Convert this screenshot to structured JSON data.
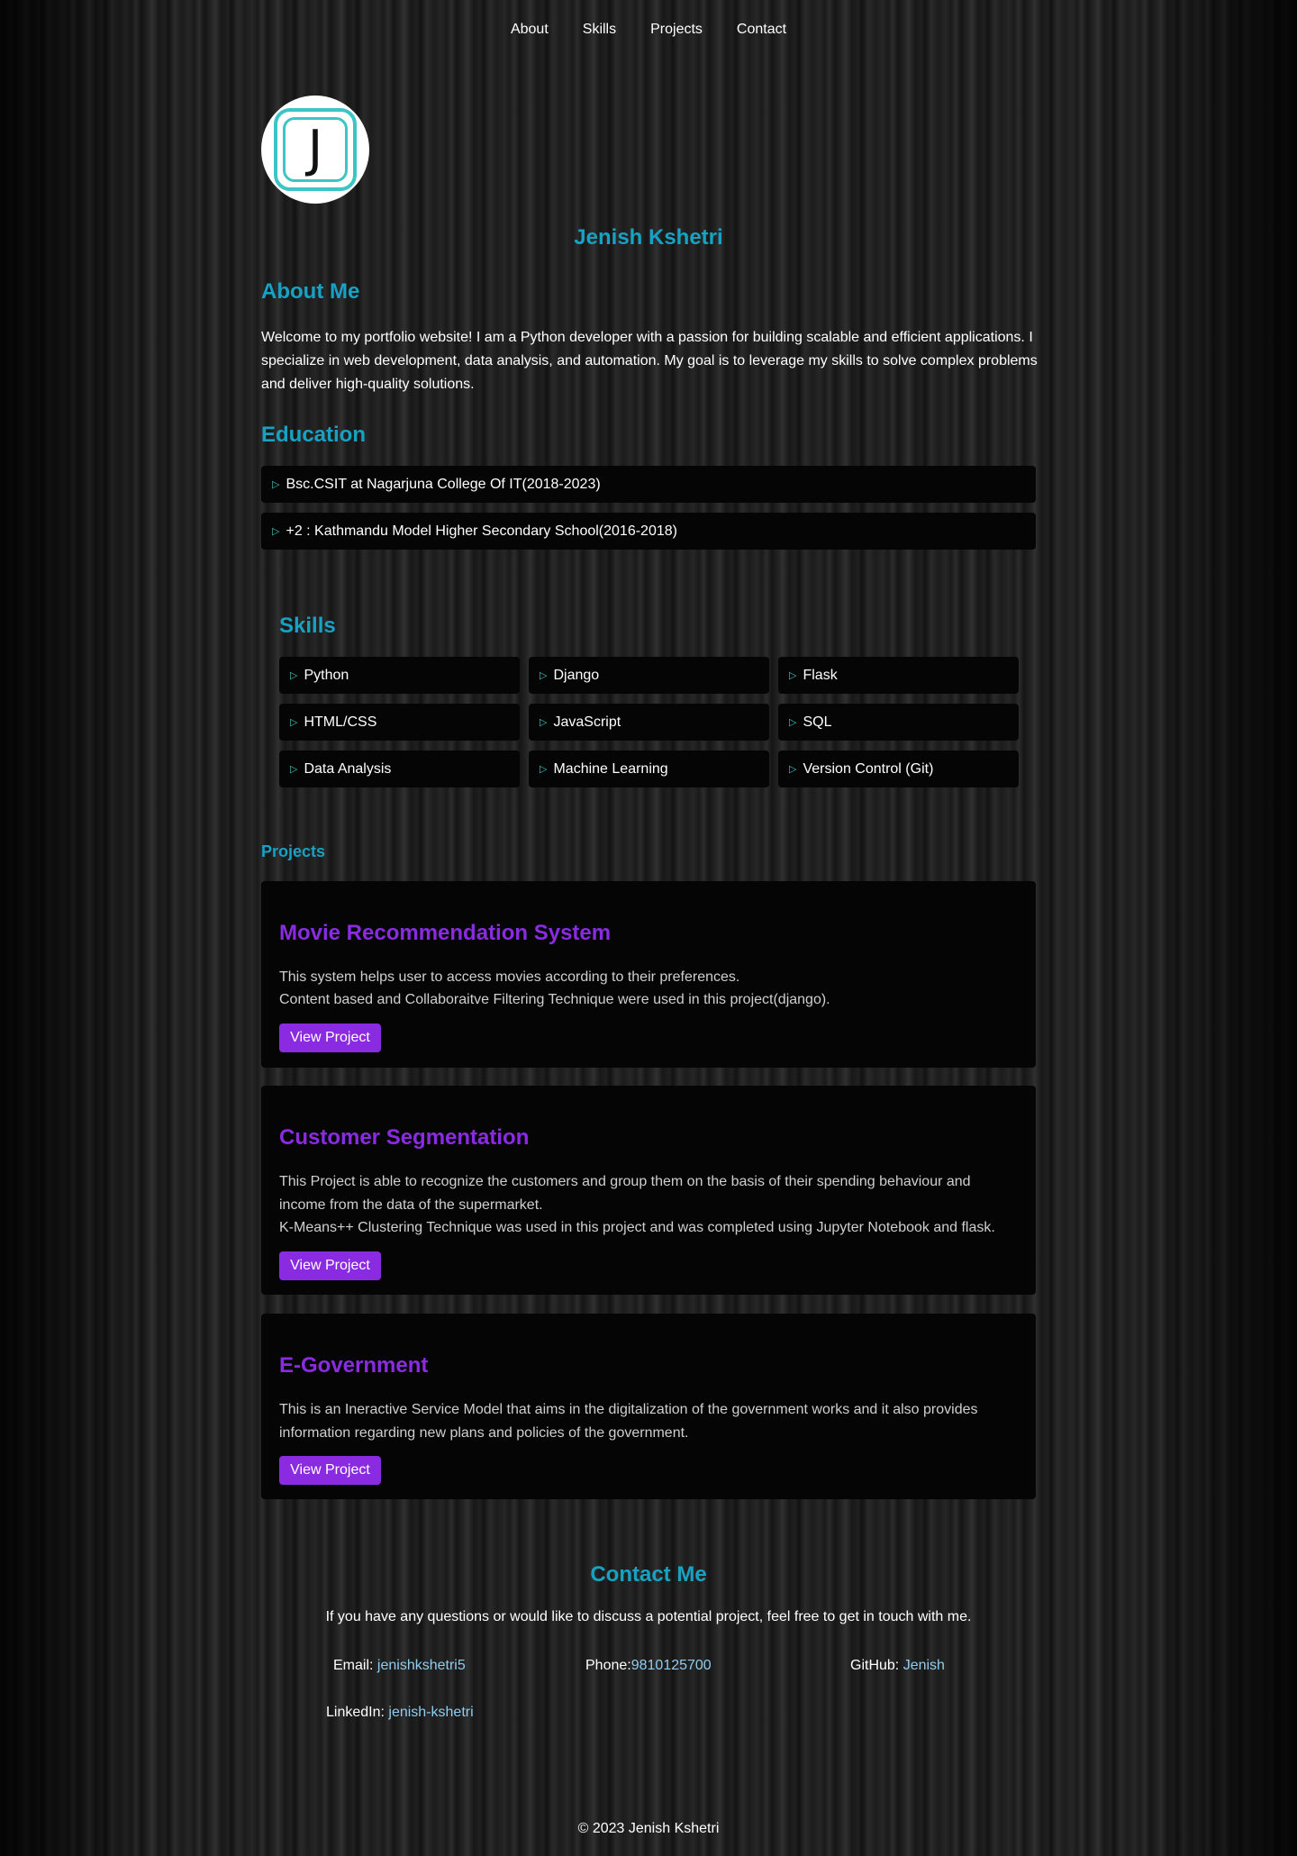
{
  "nav": {
    "items": [
      "About",
      "Skills",
      "Projects",
      "Contact"
    ]
  },
  "profile": {
    "avatar_letter": "J",
    "name": "Jenish Kshetri"
  },
  "about": {
    "title": "About Me",
    "text": "Welcome to my portfolio website! I am a Python developer with a passion for building scalable and efficient applications. I specialize in web development, data analysis, and automation. My goal is to leverage my skills to solve complex problems and deliver high-quality solutions."
  },
  "education": {
    "title": "Education",
    "items": [
      "Bsc.CSIT at Nagarjuna College Of IT(2018-2023)",
      "+2 : Kathmandu Model Higher Secondary School(2016-2018)"
    ]
  },
  "skills": {
    "title": "Skills",
    "items": [
      "Python",
      "Django",
      "Flask",
      "HTML/CSS",
      "JavaScript",
      "SQL",
      "Data Analysis",
      "Machine Learning",
      "Version Control (Git)"
    ]
  },
  "projects": {
    "title": "Projects",
    "button_label": "View Project",
    "items": [
      {
        "title": "Movie Recommendation System",
        "lines": [
          "This system helps user to access movies according to their preferences.",
          "Content based and Collaboraitve Filtering Technique were used in this project(django)."
        ]
      },
      {
        "title": "Customer Segmentation",
        "lines": [
          "This Project is able to recognize the customers and group them on the basis of their spending behaviour and income from the data of the supermarket.",
          "K-Means++ Clustering Technique was used in this project and was completed using Jupyter Notebook and flask."
        ]
      },
      {
        "title": "E-Government",
        "lines": [
          "This is an Ineractive Service Model that aims in the digitalization of the government works and it also provides information regarding new plans and policies of the government."
        ]
      }
    ]
  },
  "contact": {
    "title": "Contact Me",
    "intro": "If you have any questions or would like to discuss a potential project, feel free to get in touch with me.",
    "email_label": "Email: ",
    "email_value": "jenishkshetri5",
    "phone_label": "Phone:",
    "phone_value": "9810125700",
    "github_label": "GitHub: ",
    "github_value": "Jenish",
    "linkedin_label": "LinkedIn: ",
    "linkedin_value": "jenish-kshetri"
  },
  "footer": {
    "text": "© 2023 Jenish Kshetri"
  },
  "colors": {
    "accent_teal": "#17a2c4",
    "accent_purple": "#8a2be2",
    "link_blue": "#8ecdf0"
  }
}
